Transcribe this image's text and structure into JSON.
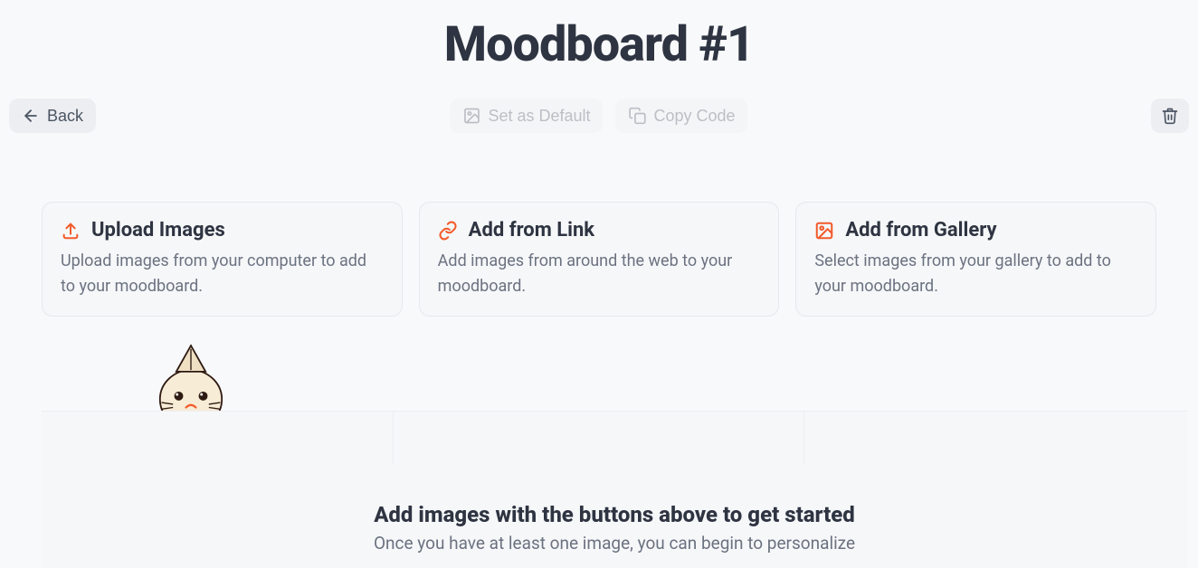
{
  "title": "Moodboard #1",
  "toolbar": {
    "back_label": "Back",
    "set_default_label": "Set as Default",
    "copy_code_label": "Copy Code"
  },
  "cards": [
    {
      "title": "Upload Images",
      "desc": "Upload images from your computer to add to your moodboard."
    },
    {
      "title": "Add from Link",
      "desc": "Add images from around the web to your moodboard."
    },
    {
      "title": "Add from Gallery",
      "desc": "Select images from your gallery to add to your moodboard."
    }
  ],
  "empty": {
    "title": "Add images with the buttons above to get started",
    "sub": "Once you have at least one image, you can begin to personalize"
  }
}
